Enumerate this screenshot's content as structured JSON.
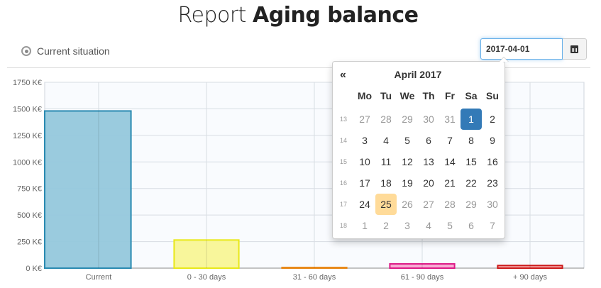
{
  "page": {
    "title_prefix": "Report",
    "title_main": "Aging balance"
  },
  "filter": {
    "radio_label": "Current situation",
    "date_value": "2017-04-01"
  },
  "datepicker": {
    "prev": "«",
    "month_title": "April 2017",
    "weekdays": [
      "Mo",
      "Tu",
      "We",
      "Th",
      "Fr",
      "Sa",
      "Su"
    ],
    "weeks": [
      {
        "num": "13",
        "days": [
          "27",
          "28",
          "29",
          "30",
          "31",
          "1",
          "2"
        ]
      },
      {
        "num": "14",
        "days": [
          "3",
          "4",
          "5",
          "6",
          "7",
          "8",
          "9"
        ]
      },
      {
        "num": "15",
        "days": [
          "10",
          "11",
          "12",
          "13",
          "14",
          "15",
          "16"
        ]
      },
      {
        "num": "16",
        "days": [
          "17",
          "18",
          "19",
          "20",
          "21",
          "22",
          "23"
        ]
      },
      {
        "num": "17",
        "days": [
          "24",
          "25",
          "26",
          "27",
          "28",
          "29",
          "30"
        ]
      },
      {
        "num": "18",
        "days": [
          "1",
          "2",
          "3",
          "4",
          "5",
          "6",
          "7"
        ]
      }
    ],
    "selected": "1",
    "today": "25",
    "colors": {
      "selected": "#337ab7",
      "today": "#ffdb99"
    }
  },
  "chart_data": {
    "type": "bar",
    "categories": [
      "Current",
      "0 - 30 days",
      "31 - 60 days",
      "61 - 90 days",
      "+ 90 days"
    ],
    "values": [
      1480,
      265,
      5,
      40,
      25
    ],
    "ylim": [
      0,
      1750
    ],
    "yticks": [
      0,
      250,
      500,
      750,
      1000,
      1250,
      1500,
      1750
    ],
    "ytick_labels": [
      "0 K€",
      "250 K€",
      "500 K€",
      "750 K€",
      "1000 K€",
      "1250 K€",
      "1500 K€",
      "1750 K€"
    ],
    "grid": true,
    "colors": [
      {
        "fill": "#95c8dc",
        "stroke": "#2a8ab1"
      },
      {
        "fill": "#f8f596",
        "stroke": "#e8e81a"
      },
      {
        "fill": "#f5c28e",
        "stroke": "#e8891a"
      },
      {
        "fill": "#f8a8d1",
        "stroke": "#dd1a87"
      },
      {
        "fill": "#f7a5a5",
        "stroke": "#cc1a1a"
      }
    ]
  }
}
